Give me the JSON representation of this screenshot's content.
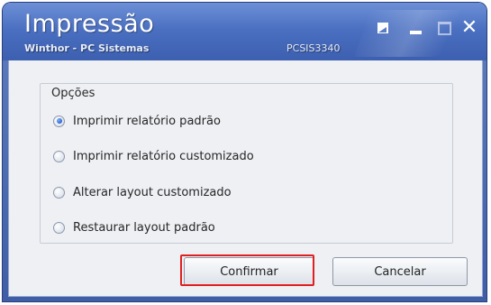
{
  "window": {
    "title": "Impressão",
    "subtitle": "Winthor - PC Sistemas",
    "code": "PCSIS3340"
  },
  "title_controls": {
    "restore_icon": "edit-window-icon",
    "minimize_icon": "minimize-icon",
    "maximize_icon": "maximize-icon",
    "close_symbol": "✕"
  },
  "options_group": {
    "label": "Opções",
    "items": [
      {
        "label": "Imprimir relatório padrão",
        "checked": true
      },
      {
        "label": "Imprimir relatório customizado",
        "checked": false
      },
      {
        "label": "Alterar layout customizado",
        "checked": false
      },
      {
        "label": "Restaurar layout padrão",
        "checked": false
      }
    ]
  },
  "buttons": {
    "confirm": "Confirmar",
    "cancel": "Cancelar"
  },
  "colors": {
    "titlebar": "#4a6fc0",
    "highlight": "#e02020",
    "client_bg": "#eef0f4"
  }
}
